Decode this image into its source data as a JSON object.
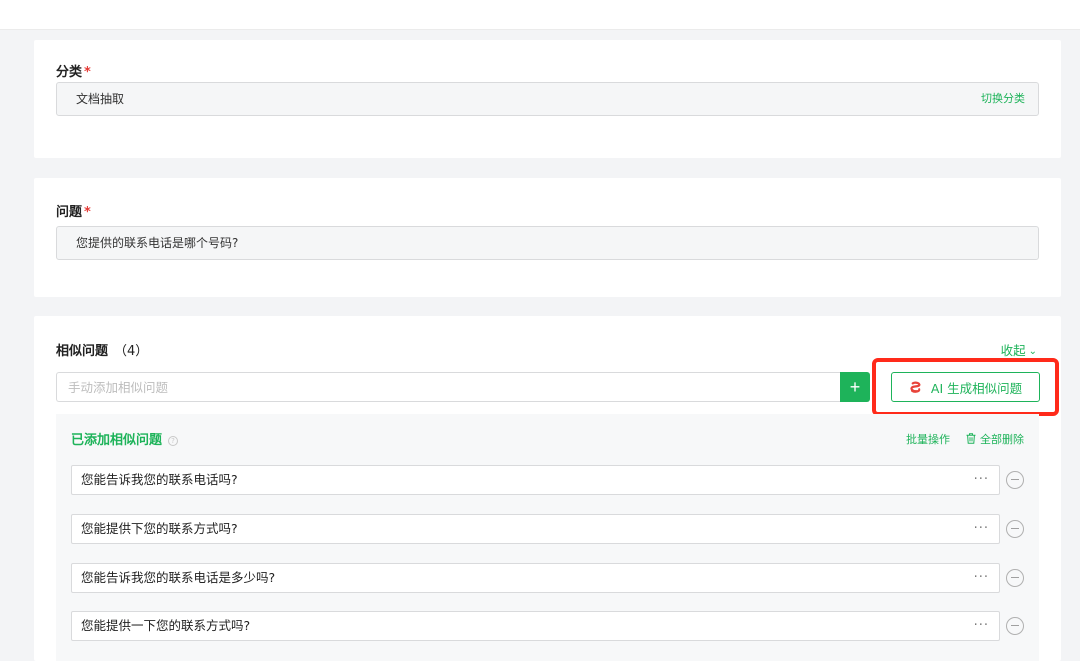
{
  "category": {
    "label": "分类",
    "required_mark": "*",
    "value": "文档抽取",
    "switch_label": "切换分类"
  },
  "question": {
    "label": "问题",
    "required_mark": "*",
    "value": "您提供的联系电话是哪个号码?"
  },
  "similar": {
    "title": "相似问题",
    "count": "（4）",
    "collapse_label": "收起",
    "add_placeholder": "手动添加相似问题",
    "add_button": "+",
    "ai_button_label": "AI 生成相似问题",
    "added_title": "已添加相似问题",
    "help_icon": "?",
    "batch_label": "批量操作",
    "delete_all_label": "全部删除",
    "more_label": "···",
    "items": [
      "您能告诉我您的联系电话吗?",
      "您能提供下您的联系方式吗?",
      "您能告诉我您的联系电话是多少吗?",
      "您能提供一下您的联系方式吗?"
    ]
  },
  "colors": {
    "accent": "#1eb35a",
    "highlight": "#ff2a1a",
    "required": "#e53935"
  },
  "icons": {
    "ai": "ai-logo-icon",
    "trash": "trash-icon",
    "chevron": "chevron-down-icon",
    "remove": "minus-circle-icon",
    "help": "help-circle-icon"
  }
}
